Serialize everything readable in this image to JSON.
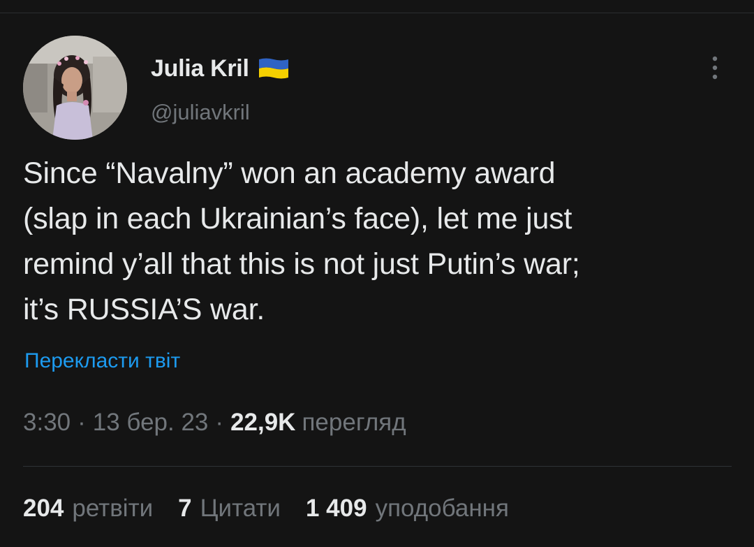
{
  "author": {
    "display_name": "Julia Kril",
    "username": "@juliavkril",
    "flag_icon": "ukraine-flag-icon",
    "flag_colors": {
      "top": "#2f63c4",
      "bottom": "#f5d000"
    }
  },
  "tweet": {
    "text": "Since “Navalny” won an academy award\n(slap in each Ukrainian’s face), let me just\nremind y’all that this is not just Putin’s war;\nit’s RUSSIA’S war.",
    "translate_label": "Перекласти твіт"
  },
  "meta": {
    "time": "3:30",
    "date": "13 бер. 23",
    "separator": "·",
    "views_count": "22,9K",
    "views_label": "перегляд"
  },
  "stats": {
    "retweets_count": "204",
    "retweets_label": "ретвіти",
    "quotes_count": "7",
    "quotes_label": "Цитати",
    "likes_count": "1 409",
    "likes_label": "уподобання"
  },
  "icons": {
    "more": "more-vertical-icon"
  },
  "colors": {
    "background": "#141414",
    "text_primary": "#e7e9ea",
    "text_secondary": "#71767b",
    "link": "#1d9bf0",
    "divider": "#2f3336"
  }
}
